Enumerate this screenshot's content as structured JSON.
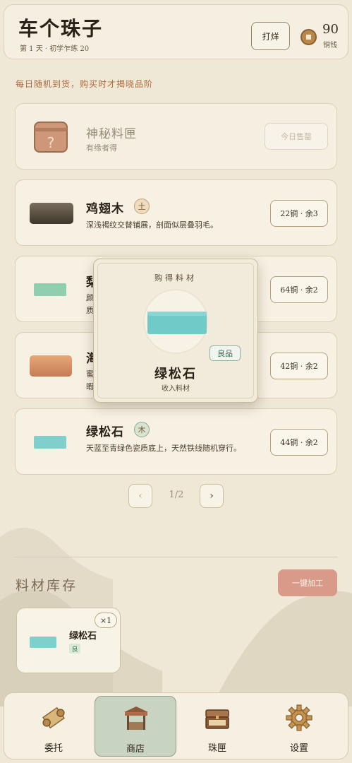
{
  "header": {
    "title": "车个珠子",
    "subtitle": "第 1 天 · 初学乍练 20",
    "action_label": "打烊",
    "coins_value": "90",
    "coins_label": "铜钱"
  },
  "notice": "每日随机到货，购买时才揭晓品阶",
  "mystery": {
    "name": "神秘料匣",
    "desc": "有缘者得",
    "button_label": "今日售罄"
  },
  "items": [
    {
      "name": "鸡翅木",
      "element": "土",
      "desc": "深浅褐纹交替铺展，剖面似层叠羽毛。",
      "price": "22铜 · 余3"
    },
    {
      "name": "",
      "element": "",
      "desc_lines": [
        "颜",
        "质"
      ],
      "price": "64铜 · 余2"
    },
    {
      "name": "",
      "element": "",
      "desc_lines": [
        "蜜",
        "暇"
      ],
      "price": "42铜 · 余2"
    },
    {
      "name": "绿松石",
      "element": "木",
      "desc": "天蓝至青绿色瓷质底上，天然铁线随机穿行。",
      "price": "44铜 · 余2"
    }
  ],
  "item_partial_first_chars": [
    "梨",
    "海"
  ],
  "popup": {
    "heading": "购得料材",
    "grade": "良品",
    "name": "绿松石",
    "sub": "收入料材"
  },
  "pagination": {
    "prev": "‹",
    "current": "1/2",
    "next": "›"
  },
  "inventory": {
    "title": "料材库存",
    "process_label": "一键加工",
    "items": [
      {
        "name": "绿松石",
        "grade": "良",
        "count": "×1"
      }
    ]
  },
  "nav": [
    {
      "label": "委托",
      "icon": "scroll-icon"
    },
    {
      "label": "商店",
      "icon": "shop-stall-icon",
      "active": true
    },
    {
      "label": "珠匣",
      "icon": "treasure-chest-icon"
    },
    {
      "label": "设置",
      "icon": "gear-icon"
    }
  ],
  "colors": {
    "background": "#efe8d7",
    "accent_brown": "#b06a3a",
    "active_nav": "#c9d3c2",
    "process_button": "#d99a8a",
    "turquoise": "#7fd0cc",
    "jade": "#8fcfb0"
  }
}
